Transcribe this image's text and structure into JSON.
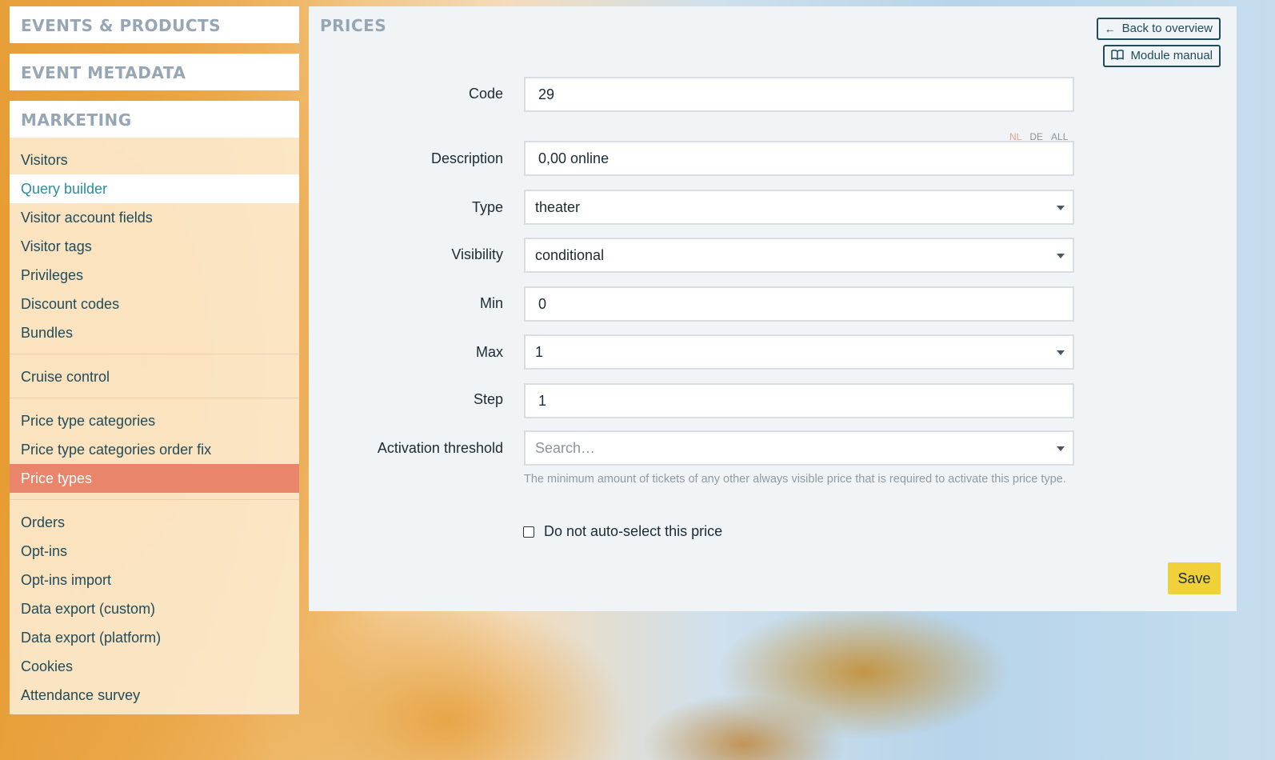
{
  "sidebar": {
    "sections": {
      "events_products": "EVENTS & PRODUCTS",
      "event_metadata": "EVENT METADATA",
      "marketing": "MARKETING"
    },
    "group1": [
      "Visitors",
      "Query builder",
      "Visitor account fields",
      "Visitor tags",
      "Privileges",
      "Discount codes",
      "Bundles"
    ],
    "group2": [
      "Cruise control"
    ],
    "group3": [
      "Price type categories",
      "Price type categories order fix",
      "Price types"
    ],
    "group4": [
      "Orders",
      "Opt-ins",
      "Opt-ins import",
      "Data export (custom)",
      "Data export (platform)",
      "Cookies",
      "Attendance survey"
    ]
  },
  "panel": {
    "title": "PRICES",
    "back_label": "Back to overview",
    "manual_label": "Module manual"
  },
  "form": {
    "code": {
      "label": "Code",
      "value": "29"
    },
    "languages": {
      "nl": "NL",
      "de": "DE",
      "all": "ALL"
    },
    "description": {
      "label": "Description",
      "value": "0,00 online"
    },
    "type": {
      "label": "Type",
      "value": "theater"
    },
    "visibility": {
      "label": "Visibility",
      "value": "conditional"
    },
    "min": {
      "label": "Min",
      "value": "0"
    },
    "max": {
      "label": "Max",
      "value": "1"
    },
    "step": {
      "label": "Step",
      "value": "1"
    },
    "activation_threshold": {
      "label": "Activation threshold",
      "placeholder": "Search…",
      "help": "The minimum amount of tickets of any other always visible price that is required to activate this price type."
    },
    "no_autoselect": {
      "label": "Do not auto-select this price",
      "checked": false
    },
    "save_label": "Save"
  },
  "colors": {
    "active_item_bg": "#e8856b",
    "save_button_bg": "#f0d13a",
    "hover_item_text": "#2a8f9a",
    "section_heading": "#96a6b4"
  },
  "icons": {
    "back": "arrow-left-icon",
    "manual": "book-icon",
    "select_caret": "caret-down-icon"
  }
}
